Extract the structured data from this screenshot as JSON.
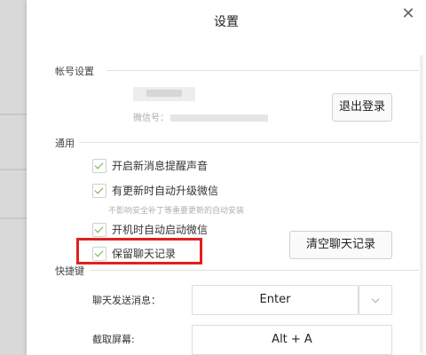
{
  "dialog": {
    "title": "设置",
    "close_glyph": "✕"
  },
  "account": {
    "section": "帐号设置",
    "wechat_id_label": "微信号：",
    "logout_label": "退出登录"
  },
  "general": {
    "section": "通用",
    "options": [
      {
        "label": "开启新消息提醒声音",
        "checked": true
      },
      {
        "label": "有更新时自动升级微信",
        "checked": true
      },
      {
        "label": "开机时自动启动微信",
        "checked": true
      },
      {
        "label": "保留聊天记录",
        "checked": true
      }
    ],
    "update_note": "不影响安全补丁等重要更新的自动安装",
    "clear_label": "清空聊天记录"
  },
  "shortcuts": {
    "section": "快捷键",
    "send_label": "聊天发送消息：",
    "send_value": "Enter",
    "dropdown_glyph": "⌵",
    "capture_label": "截取屏幕:",
    "capture_value": "Alt + A"
  },
  "colors": {
    "highlight": "#e02020",
    "check": "#6ab04c"
  }
}
